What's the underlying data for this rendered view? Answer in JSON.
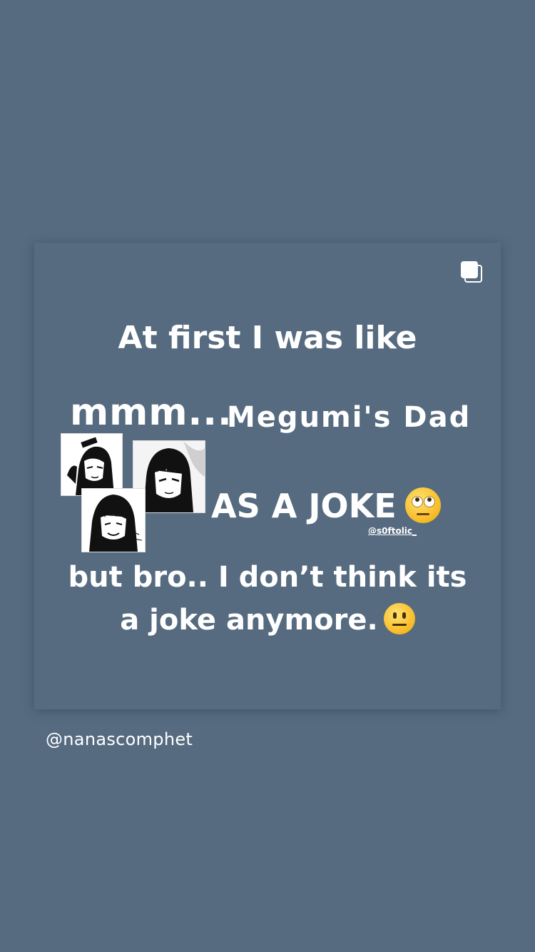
{
  "post": {
    "line1": "At first I was like",
    "mmm": "mmm...",
    "megumi": "Megumi's  Dad",
    "joke": "AS A JOKE",
    "watermark": "@s0ftolic_",
    "line4": "but bro.. I don’t think its",
    "line5": "a joke anymore.",
    "emoji_roll": "face-with-rolling-eyes",
    "emoji_neutral": "neutral-face",
    "multi_icon": "carousel-icon"
  },
  "footer": {
    "username": "@nanascomphet"
  },
  "colors": {
    "background": "#566b80",
    "text": "#ffffff"
  }
}
